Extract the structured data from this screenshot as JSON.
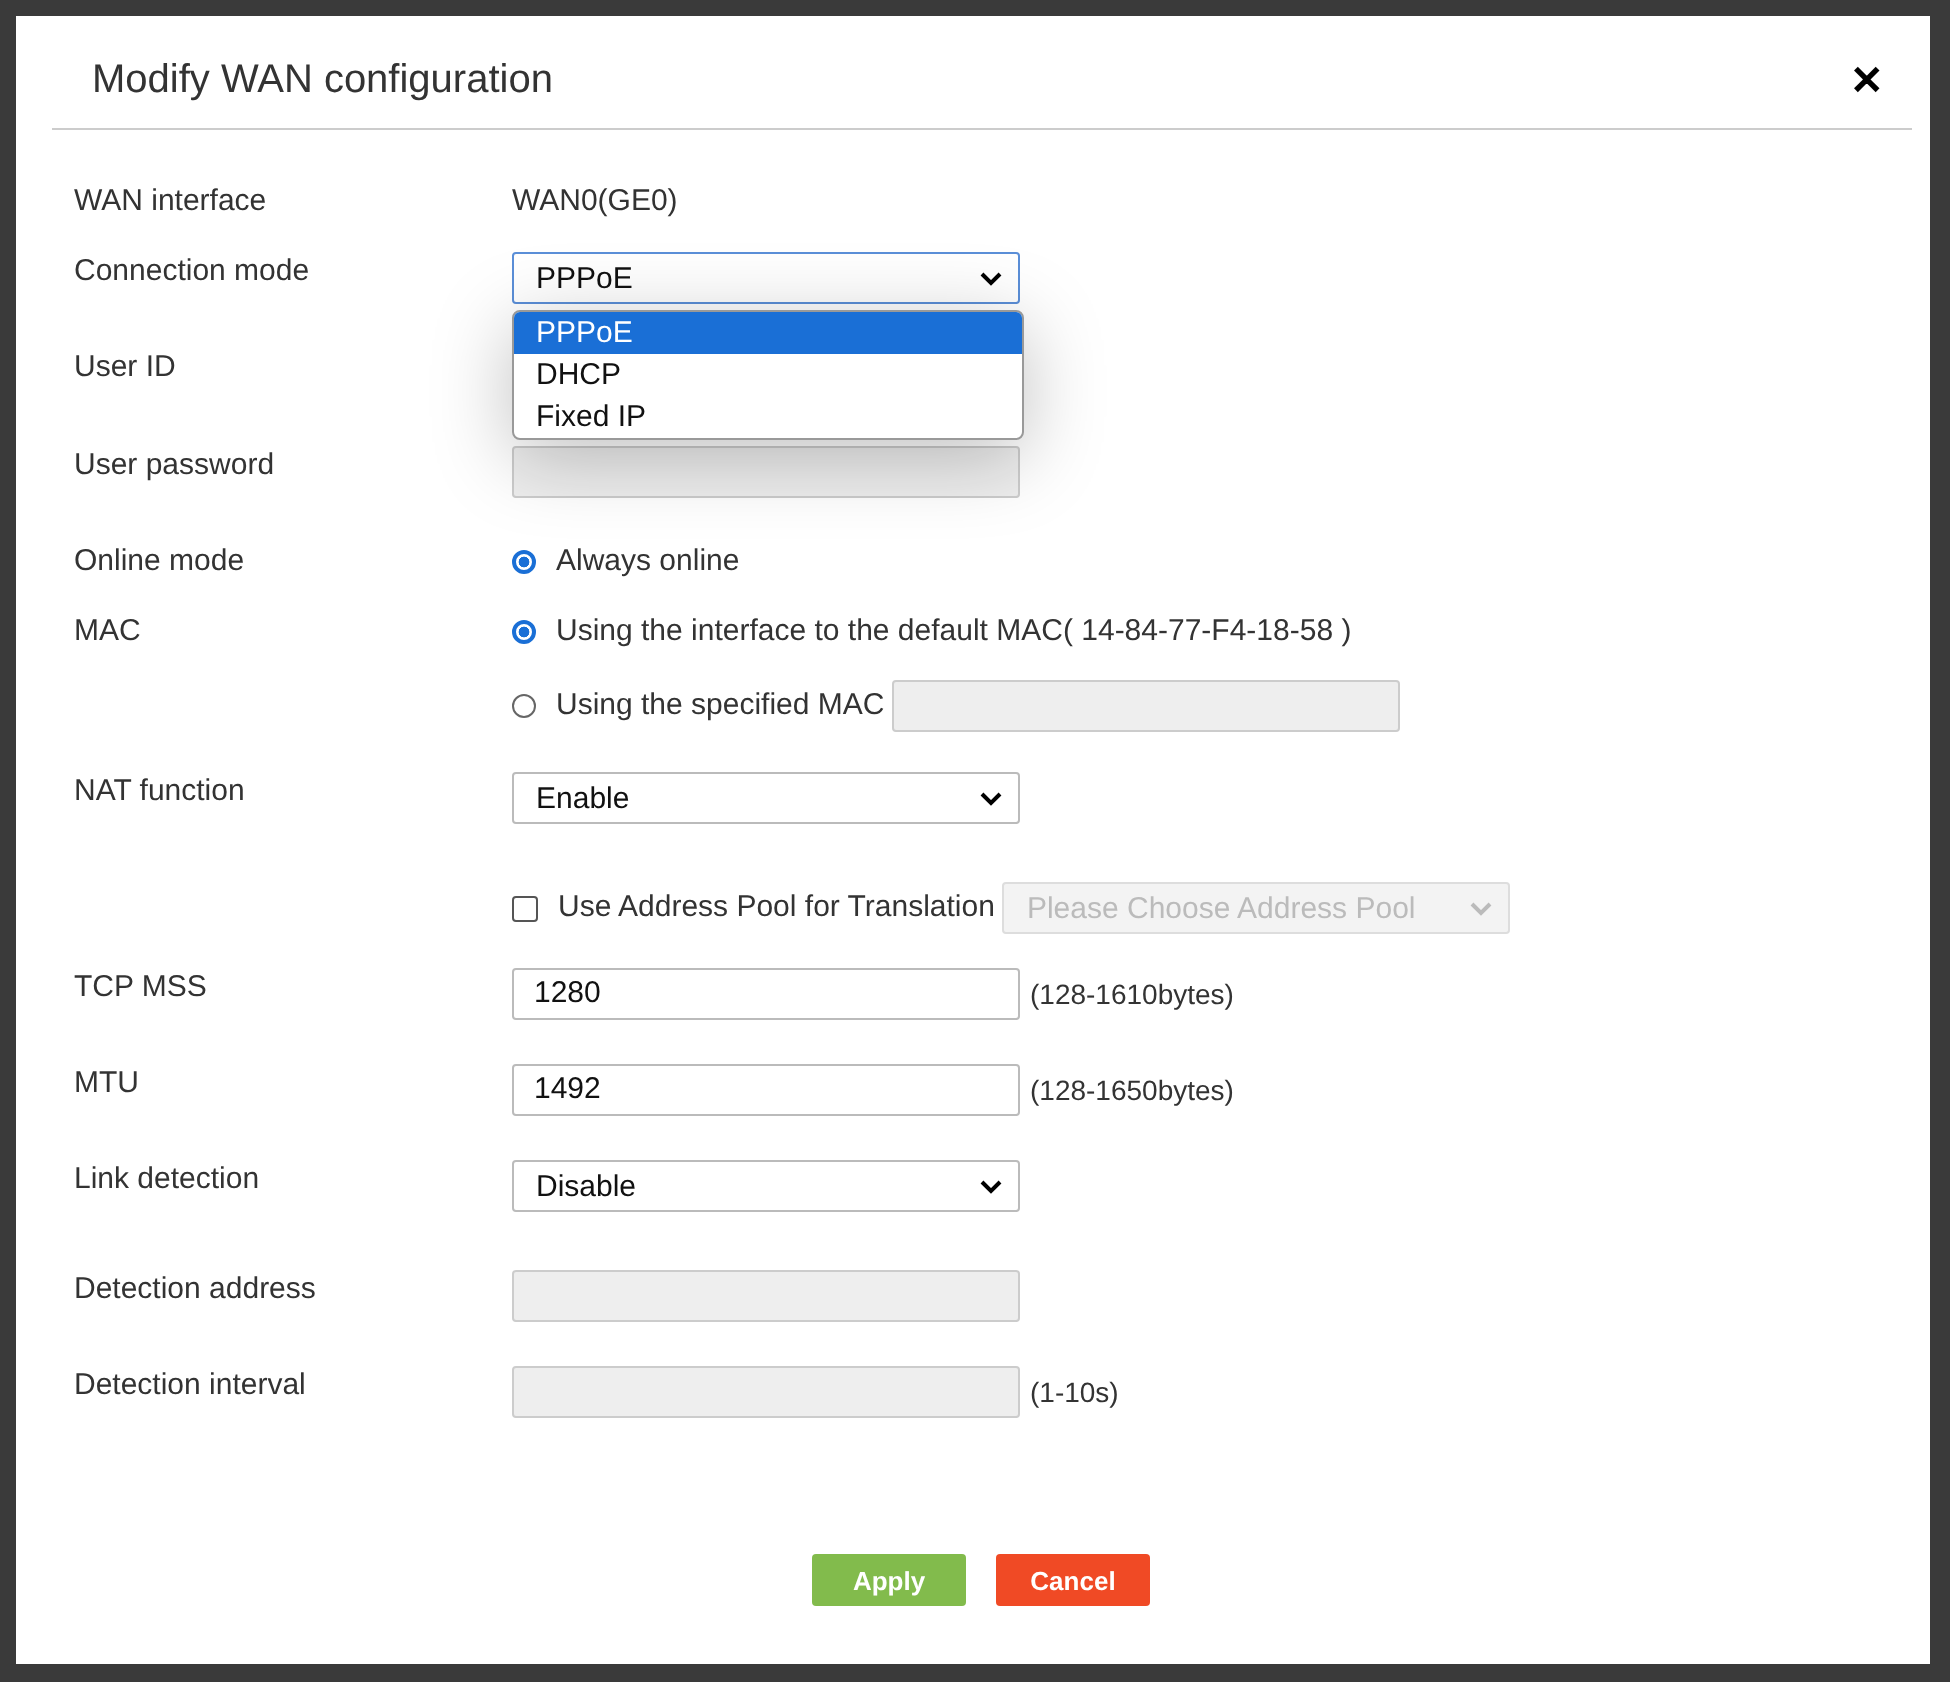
{
  "dialog": {
    "title": "Modify WAN configuration",
    "close": "✕"
  },
  "rows": [
    {
      "kind": "text",
      "label": "WAN interface",
      "value": "WAN0(GE0)"
    },
    {
      "kind": "select",
      "label": "Connection mode",
      "value": "PPPoE",
      "focused": true,
      "options": [
        {
          "label": "PPPoE",
          "selected": true
        },
        {
          "label": "DHCP",
          "selected": false
        },
        {
          "label": "Fixed IP",
          "selected": false
        }
      ]
    },
    {
      "kind": "covered",
      "label": "User ID"
    },
    {
      "kind": "input",
      "label": "User password",
      "disabled": true
    },
    {
      "kind": "radios",
      "label": "Online mode",
      "options": [
        {
          "label": "Always online",
          "selected": true
        }
      ]
    },
    {
      "kind": "radios",
      "label": "MAC",
      "options": [
        {
          "label": "Using the interface to the default MAC( 14-84-77-F4-18-58 )",
          "selected": true
        },
        {
          "label": "Using the specified MAC",
          "selected": false,
          "field": {
            "disabled": true
          }
        }
      ]
    },
    {
      "kind": "select",
      "label": "NAT function",
      "value": "Enable",
      "focused": false
    },
    {
      "kind": "checkbox",
      "label": "Use Address Pool for Translation",
      "checked": false,
      "select": {
        "placeholder": "Please Choose Address Pool",
        "disabled": true
      }
    },
    {
      "kind": "input",
      "label": "TCP MSS",
      "value": "1280",
      "disabled": false,
      "hint": "(128-1610bytes)"
    },
    {
      "kind": "input",
      "label": "MTU",
      "value": "1492",
      "disabled": false,
      "hint": "(128-1650bytes)"
    },
    {
      "kind": "select",
      "label": "Link detection",
      "value": "Disable",
      "focused": false
    },
    {
      "kind": "input",
      "label": "Detection address",
      "disabled": true
    },
    {
      "kind": "input",
      "label": "Detection interval",
      "disabled": true,
      "hint": "(1-10s)"
    }
  ],
  "buttons": [
    {
      "label": "Apply",
      "kind": "primary"
    },
    {
      "label": "Cancel",
      "kind": "danger"
    }
  ]
}
